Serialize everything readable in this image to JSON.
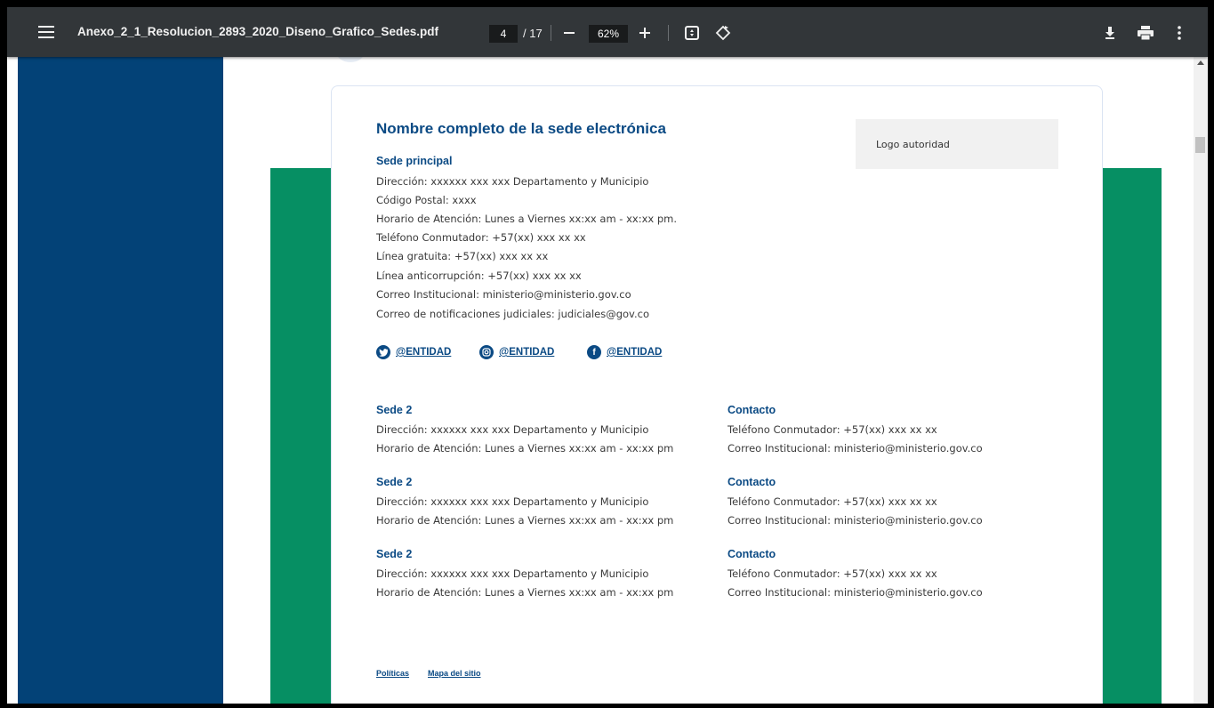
{
  "toolbar": {
    "title": "Anexo_2_1_Resolucion_2893_2020_Diseno_Grafico_Sedes.pdf",
    "current_page": "4",
    "total_pages": "/ 17",
    "zoom": "62%",
    "icons": [
      "menu-icon",
      "minus-icon",
      "plus-icon",
      "fit-page-icon",
      "rotate-icon",
      "download-icon",
      "print-icon",
      "more-vert-icon"
    ]
  },
  "card": {
    "title": "Nombre completo de la sede electrónica",
    "logo_label": "Logo autoridad",
    "main": {
      "heading": "Sede principal",
      "lines": [
        "Dirección: xxxxxx xxx xxx Departamento y Municipio",
        "Código Postal: xxxx",
        "Horario de Atención: Lunes a Viernes xx:xx am - xx:xx pm.",
        "Teléfono Conmutador: +57(xx) xxx xx xx",
        "Línea gratuita: +57(xx) xxx xx xx",
        "Línea anticorrupción: +57(xx) xxx xx xx",
        "Correo Institucional: ministerio@ministerio.gov.co",
        "Correo de notificaciones judiciales: judiciales@gov.co"
      ]
    },
    "social": [
      {
        "icon": "twitter-icon",
        "label": "@ENTIDAD"
      },
      {
        "icon": "instagram-icon",
        "label": "@ENTIDAD"
      },
      {
        "icon": "facebook-icon",
        "label": "@ENTIDAD"
      }
    ],
    "sedes": [
      {
        "heading": "Sede 2",
        "address": "Dirección: xxxxxx xxx xxx Departamento y Municipio",
        "hours": "Horario de Atención: Lunes a Viernes xx:xx am - xx:xx pm",
        "contact_heading": "Contacto",
        "phone": "Teléfono Conmutador: +57(xx) xxx xx xx",
        "email": "Correo Institucional: ministerio@ministerio.gov.co"
      },
      {
        "heading": "Sede 2",
        "address": "Dirección: xxxxxx xxx xxx Departamento y Municipio",
        "hours": "Horario de Atención: Lunes a Viernes xx:xx am - xx:xx pm",
        "contact_heading": "Contacto",
        "phone": "Teléfono Conmutador: +57(xx) xxx xx xx",
        "email": "Correo Institucional: ministerio@ministerio.gov.co"
      },
      {
        "heading": "Sede 2",
        "address": "Dirección: xxxxxx xxx xxx Departamento y Municipio",
        "hours": "Horario de Atención: Lunes a Viernes xx:xx am - xx:xx pm",
        "contact_heading": "Contacto",
        "phone": "Teléfono Conmutador: +57(xx) xxx xx xx",
        "email": "Correo Institucional: ministerio@ministerio.gov.co"
      }
    ],
    "footer_links": [
      "Políticas",
      "Mapa del sitio"
    ]
  },
  "colors": {
    "toolbar_bg": "#323639",
    "brand_blue": "#0b4a84",
    "left_panel": "#034277",
    "green_band": "#068f63"
  }
}
